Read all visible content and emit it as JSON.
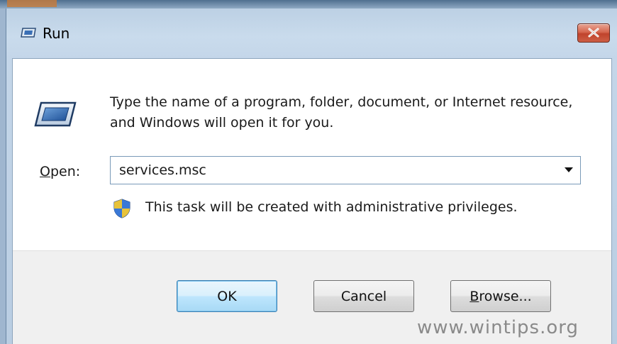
{
  "window": {
    "title": "Run",
    "close_label": "X"
  },
  "dialog": {
    "description": "Type the name of a program, folder, document, or Internet resource, and Windows will open it for you.",
    "open_label_accel": "O",
    "open_label_rest": "pen:",
    "open_value": "services.msc",
    "admin_note": "This task will be created with administrative privileges."
  },
  "buttons": {
    "ok": "OK",
    "cancel": "Cancel",
    "browse_accel": "B",
    "browse_rest": "rowse..."
  },
  "watermark": "www.wintips.org",
  "icons": {
    "title": "run-icon",
    "main": "run-icon",
    "shield": "uac-shield-icon",
    "close": "close-icon",
    "dropdown": "chevron-down-icon"
  },
  "colors": {
    "titlebar": "#c4d6e9",
    "close_button": "#c7452e",
    "ok_button_border": "#3c7fb1",
    "footer": "#f0f0f0"
  }
}
